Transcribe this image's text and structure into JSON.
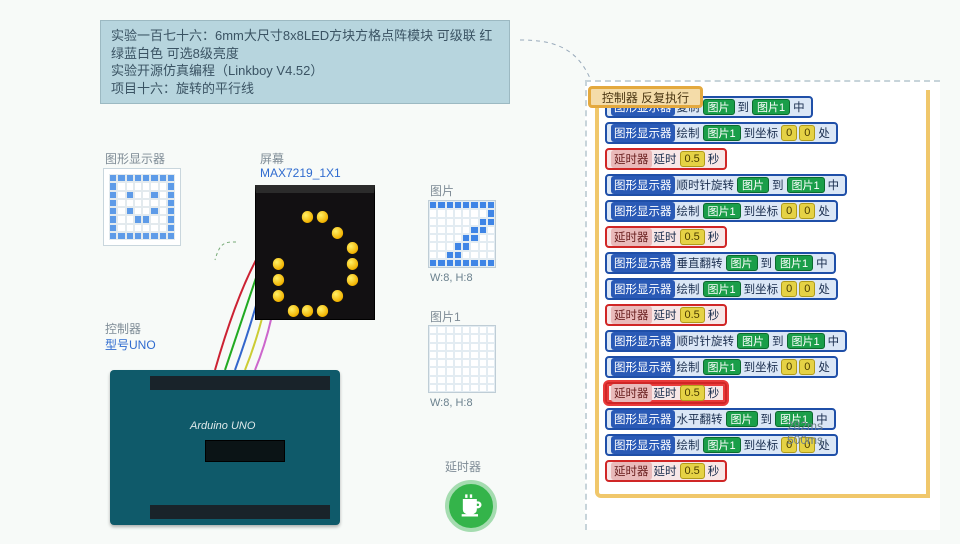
{
  "info": {
    "line1": "实验一百七十六：6mm大尺寸8x8LED方块方格点阵模块 可级联 红绿蓝白色 可选8级亮度",
    "line2": "实验开源仿真编程（Linkboy V4.52）",
    "line3": "项目十六：旋转的平行线"
  },
  "labels": {
    "graphDisplay": "图形显示器",
    "screen": "屏幕",
    "screenModel": "MAX7219_1X1",
    "controller": "控制器",
    "controllerModel": "型号UNO",
    "arduinoBrand": "Arduino UNO",
    "pic": "图片",
    "pic1": "图片1",
    "picDim": "W:8, H:8",
    "pic1Dim": "W:8, H:8",
    "delay": "延时器"
  },
  "blocksHeader": "控制器 反复执行",
  "timing": {
    "t1": "282ms",
    "t2": "500ms"
  },
  "vocab": {
    "graphDisplay": "图形显示器",
    "copy": "复制",
    "draw": "绘制",
    "to": "到",
    "middle": "中",
    "toCoord": "到坐标",
    "at": "处",
    "delayUnit": "延时器",
    "delayWord": "延时",
    "sec": "秒",
    "rotCW": "顺时针旋转",
    "flipV": "垂直翻转",
    "flipH": "水平翻转",
    "pic": "图片",
    "pic1": "图片1",
    "coord0": "0",
    "delayVal": "0.5"
  },
  "ledPattern": [
    [
      0,
      0,
      0,
      0,
      0,
      0,
      0,
      0
    ],
    [
      0,
      0,
      0,
      1,
      1,
      0,
      0,
      0
    ],
    [
      0,
      0,
      0,
      0,
      0,
      1,
      0,
      0
    ],
    [
      0,
      0,
      0,
      0,
      0,
      0,
      1,
      0
    ],
    [
      0,
      1,
      0,
      0,
      0,
      0,
      1,
      0
    ],
    [
      0,
      1,
      0,
      0,
      0,
      0,
      1,
      0
    ],
    [
      0,
      1,
      0,
      0,
      0,
      1,
      0,
      0
    ],
    [
      0,
      0,
      1,
      1,
      1,
      0,
      0,
      0
    ]
  ],
  "picPattern": [
    [
      1,
      1,
      1,
      1,
      1,
      1,
      1,
      1
    ],
    [
      0,
      0,
      0,
      0,
      0,
      0,
      0,
      1
    ],
    [
      0,
      0,
      0,
      0,
      0,
      0,
      1,
      1
    ],
    [
      0,
      0,
      0,
      0,
      0,
      1,
      1,
      0
    ],
    [
      0,
      0,
      0,
      0,
      1,
      1,
      0,
      0
    ],
    [
      0,
      0,
      0,
      1,
      1,
      0,
      0,
      0
    ],
    [
      0,
      0,
      1,
      1,
      0,
      0,
      0,
      0
    ],
    [
      1,
      1,
      1,
      1,
      1,
      1,
      1,
      1
    ]
  ],
  "blockRows": [
    {
      "kind": "disp",
      "parts": [
        "graphDisplay",
        "copy",
        {
          "slot": "pic",
          "c": "g"
        },
        "to",
        {
          "slot": "pic1",
          "c": "g"
        },
        "middle"
      ]
    },
    {
      "kind": "disp",
      "parts": [
        "graphDisplay",
        "draw",
        {
          "slot": "pic1",
          "c": "g"
        },
        "toCoord",
        {
          "slot": "coord0",
          "c": "y"
        },
        {
          "slot": "coord0",
          "c": "y"
        },
        "at"
      ]
    },
    {
      "kind": "delay",
      "parts": [
        "delayUnit",
        "delayWord",
        {
          "slot": "delayVal",
          "c": "y"
        },
        "sec"
      ]
    },
    {
      "kind": "disp",
      "parts": [
        "graphDisplay",
        "rotCW",
        {
          "slot": "pic",
          "c": "g"
        },
        "to",
        {
          "slot": "pic1",
          "c": "g"
        },
        "middle"
      ]
    },
    {
      "kind": "disp",
      "parts": [
        "graphDisplay",
        "draw",
        {
          "slot": "pic1",
          "c": "g"
        },
        "toCoord",
        {
          "slot": "coord0",
          "c": "y"
        },
        {
          "slot": "coord0",
          "c": "y"
        },
        "at"
      ]
    },
    {
      "kind": "delay",
      "parts": [
        "delayUnit",
        "delayWord",
        {
          "slot": "delayVal",
          "c": "y"
        },
        "sec"
      ]
    },
    {
      "kind": "disp",
      "parts": [
        "graphDisplay",
        "flipV",
        {
          "slot": "pic",
          "c": "g"
        },
        "to",
        {
          "slot": "pic1",
          "c": "g"
        },
        "middle"
      ]
    },
    {
      "kind": "disp",
      "parts": [
        "graphDisplay",
        "draw",
        {
          "slot": "pic1",
          "c": "g"
        },
        "toCoord",
        {
          "slot": "coord0",
          "c": "y"
        },
        {
          "slot": "coord0",
          "c": "y"
        },
        "at"
      ]
    },
    {
      "kind": "delay",
      "parts": [
        "delayUnit",
        "delayWord",
        {
          "slot": "delayVal",
          "c": "y"
        },
        "sec"
      ]
    },
    {
      "kind": "disp",
      "parts": [
        "graphDisplay",
        "rotCW",
        {
          "slot": "pic",
          "c": "g"
        },
        "to",
        {
          "slot": "pic1",
          "c": "g"
        },
        "middle"
      ]
    },
    {
      "kind": "disp",
      "parts": [
        "graphDisplay",
        "draw",
        {
          "slot": "pic1",
          "c": "g"
        },
        "toCoord",
        {
          "slot": "coord0",
          "c": "y"
        },
        {
          "slot": "coord0",
          "c": "y"
        },
        "at"
      ]
    },
    {
      "kind": "delay",
      "parts": [
        "delayUnit",
        "delayWord",
        {
          "slot": "delayVal",
          "c": "y"
        },
        "sec"
      ],
      "highlight": true
    },
    {
      "kind": "disp",
      "parts": [
        "graphDisplay",
        "flipH",
        {
          "slot": "pic",
          "c": "g"
        },
        "to",
        {
          "slot": "pic1",
          "c": "g"
        },
        "middle"
      ]
    },
    {
      "kind": "disp",
      "parts": [
        "graphDisplay",
        "draw",
        {
          "slot": "pic1",
          "c": "g"
        },
        "toCoord",
        {
          "slot": "coord0",
          "c": "y"
        },
        {
          "slot": "coord0",
          "c": "y"
        },
        "at"
      ]
    },
    {
      "kind": "delay",
      "parts": [
        "delayUnit",
        "delayWord",
        {
          "slot": "delayVal",
          "c": "y"
        },
        "sec"
      ]
    }
  ]
}
